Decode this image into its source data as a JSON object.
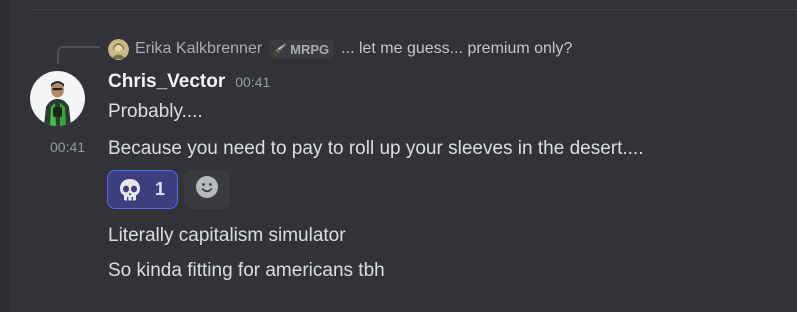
{
  "reply": {
    "author": "Erika Kalkbrenner",
    "role_tag": "MRPG",
    "role_icon": "sword-icon",
    "text": "... let me guess... premium only?"
  },
  "message": {
    "author": "Chris_Vector",
    "timestamp": "00:41",
    "lines": [
      "Probably....",
      "Because you need to pay to roll up your sleeves in the desert....",
      "Literally capitalism simulator",
      "So kinda fitting for americans tbh"
    ],
    "line_timestamp": "00:41"
  },
  "reactions": [
    {
      "emoji": "skull-icon",
      "count": "1",
      "active": true
    }
  ],
  "add_reaction_icon": "smiley-face-icon",
  "colors": {
    "background": "#313338",
    "author": "#f2f3f5",
    "reaction_active_bg": "#3c3f7d",
    "reaction_active_border": "#5865f2"
  }
}
